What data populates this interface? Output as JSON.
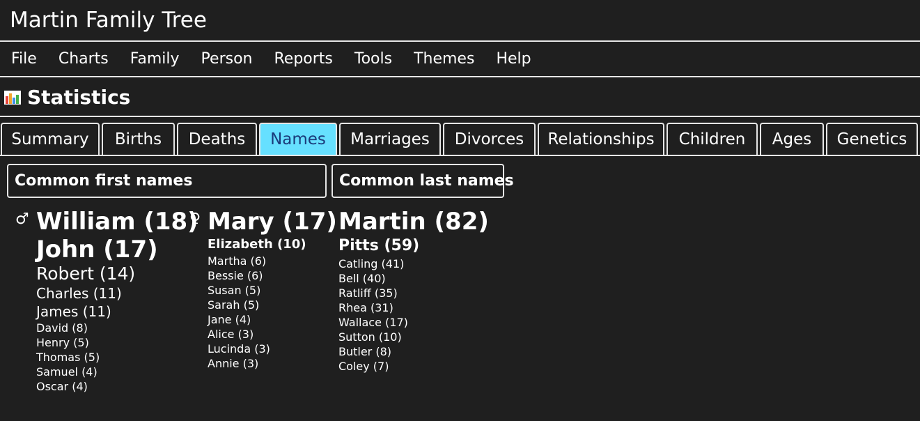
{
  "app": {
    "title": "Martin Family Tree"
  },
  "menu": [
    "File",
    "Charts",
    "Family",
    "Person",
    "Reports",
    "Tools",
    "Themes",
    "Help"
  ],
  "section": {
    "title": "Statistics"
  },
  "tabs": [
    {
      "label": "Summary",
      "active": false
    },
    {
      "label": "Births",
      "active": false
    },
    {
      "label": "Deaths",
      "active": false
    },
    {
      "label": "Names",
      "active": true
    },
    {
      "label": "Marriages",
      "active": false
    },
    {
      "label": "Divorces",
      "active": false
    },
    {
      "label": "Relationships",
      "active": false
    },
    {
      "label": "Children",
      "active": false
    },
    {
      "label": "Ages",
      "active": false
    },
    {
      "label": "Genetics",
      "active": false
    }
  ],
  "first_names": {
    "header": "Common first names",
    "male_symbol": "♂",
    "female_symbol": "♀",
    "male": [
      {
        "text": "William (18)"
      },
      {
        "text": "John (17)"
      },
      {
        "text": "Robert (14)"
      },
      {
        "text": "Charles (11)"
      },
      {
        "text": "James (11)"
      },
      {
        "text": "David (8)"
      },
      {
        "text": "Henry (5)"
      },
      {
        "text": "Thomas (5)"
      },
      {
        "text": "Samuel (4)"
      },
      {
        "text": "Oscar (4)"
      }
    ],
    "female": [
      {
        "text": "Mary (17)"
      },
      {
        "text": "Elizabeth (10)"
      },
      {
        "text": "Martha (6)"
      },
      {
        "text": "Bessie (6)"
      },
      {
        "text": "Susan (5)"
      },
      {
        "text": "Sarah (5)"
      },
      {
        "text": "Jane (4)"
      },
      {
        "text": "Alice (3)"
      },
      {
        "text": "Lucinda (3)"
      },
      {
        "text": "Annie (3)"
      }
    ]
  },
  "last_names": {
    "header": "Common last names",
    "items": [
      {
        "text": "Martin (82)"
      },
      {
        "text": "Pitts (59)"
      },
      {
        "text": "Catling (41)"
      },
      {
        "text": "Bell (40)"
      },
      {
        "text": "Ratliff (35)"
      },
      {
        "text": "Rhea (31)"
      },
      {
        "text": "Wallace (17)"
      },
      {
        "text": "Sutton (10)"
      },
      {
        "text": "Butler (8)"
      },
      {
        "text": "Coley (7)"
      }
    ]
  },
  "colors": {
    "background": "#1f1f1f",
    "active_tab": "#66e0ff",
    "active_tab_text": "#1a3a7a",
    "border": "#e6e6e6"
  }
}
